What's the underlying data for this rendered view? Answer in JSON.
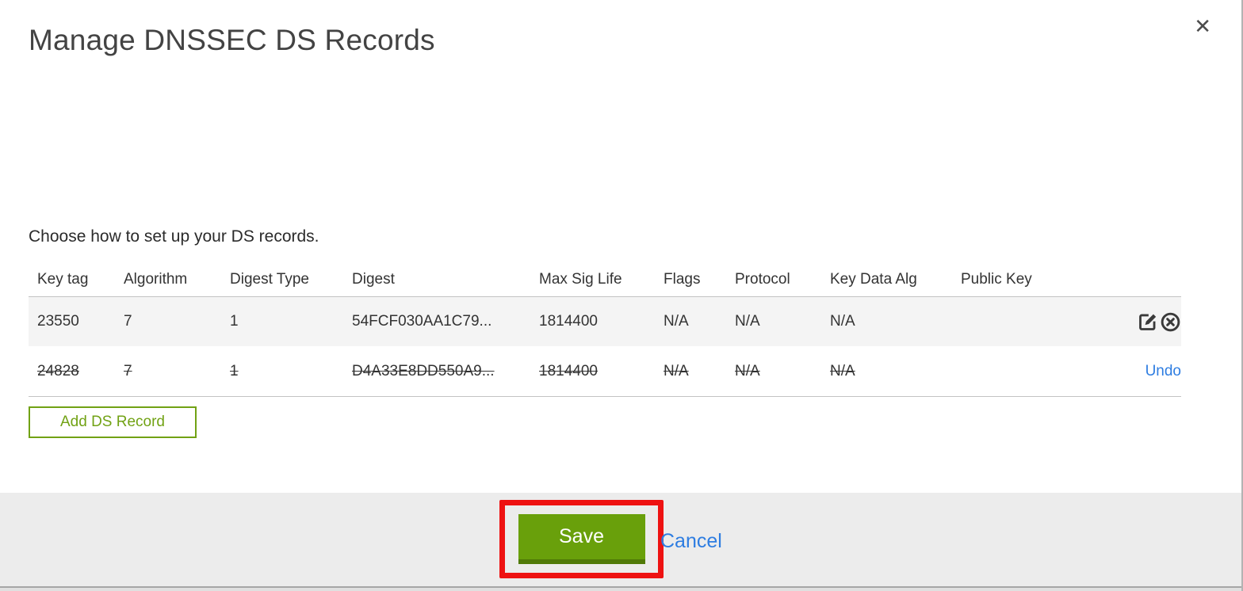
{
  "dialog": {
    "title": "Manage DNSSEC DS Records",
    "intro": "Choose how to set up your DS records."
  },
  "icons": {
    "close": "✕",
    "edit": "edit-pencil-square",
    "delete": "x-in-circle"
  },
  "table": {
    "columns": [
      "Key tag",
      "Algorithm",
      "Digest Type",
      "Digest",
      "Max Sig Life",
      "Flags",
      "Protocol",
      "Key Data Alg",
      "Public Key"
    ],
    "rows": [
      {
        "key_tag": "23550",
        "algorithm": "7",
        "digest_type": "1",
        "digest": "54FCF030AA1C79...",
        "max_sig_life": "1814400",
        "flags": "N/A",
        "protocol": "N/A",
        "key_data_alg": "N/A",
        "public_key": "",
        "state": "active"
      },
      {
        "key_tag": "24828",
        "algorithm": "7",
        "digest_type": "1",
        "digest": "D4A33E8DD550A9...",
        "max_sig_life": "1814400",
        "flags": "N/A",
        "protocol": "N/A",
        "key_data_alg": "N/A",
        "public_key": "",
        "state": "marked-for-deletion",
        "undo_label": "Undo"
      }
    ]
  },
  "buttons": {
    "add_ds_record": "Add DS Record",
    "save": "Save",
    "cancel": "Cancel"
  },
  "colors": {
    "accent_green": "#69a00b",
    "green_dark": "#507a08",
    "outline_green": "#71a214",
    "link_blue": "#2e7de1",
    "annotation_red": "#ee1212",
    "row_alt_bg": "#f4f4f4",
    "footer_bg": "#ececec"
  }
}
